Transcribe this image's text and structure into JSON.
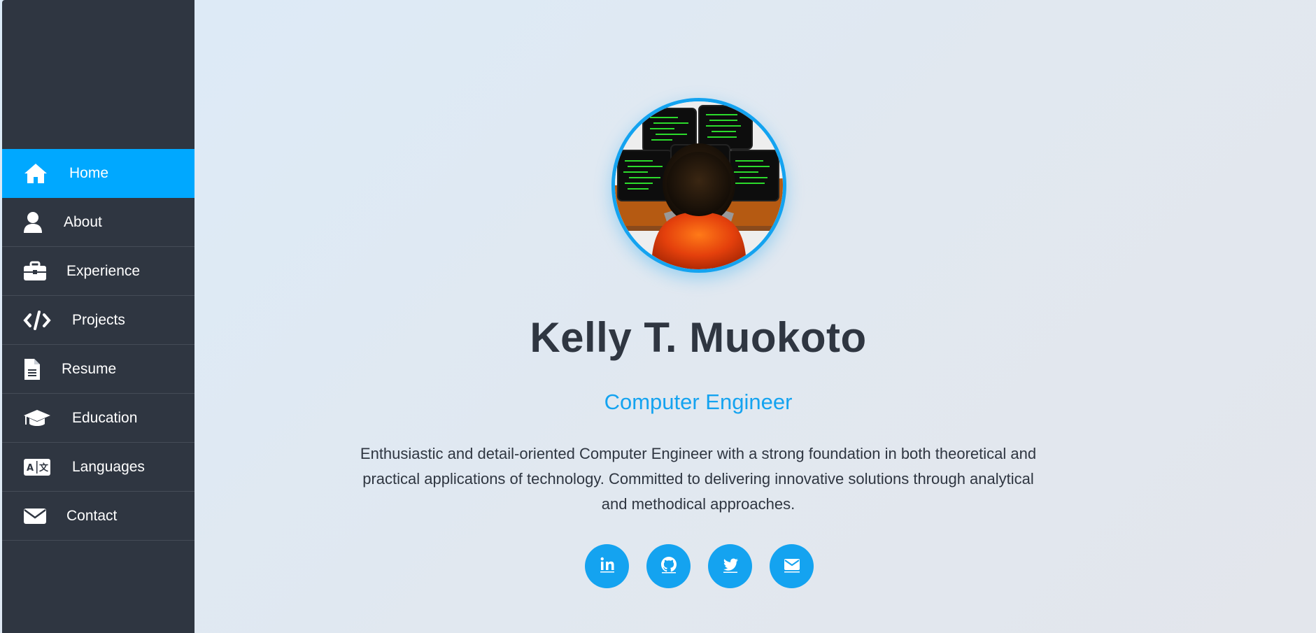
{
  "sidebar": {
    "items": [
      {
        "label": "Home",
        "icon": "home-icon",
        "active": true
      },
      {
        "label": "About",
        "icon": "user-icon",
        "active": false
      },
      {
        "label": "Experience",
        "icon": "briefcase-icon",
        "active": false
      },
      {
        "label": "Projects",
        "icon": "code-icon",
        "active": false
      },
      {
        "label": "Resume",
        "icon": "file-icon",
        "active": false
      },
      {
        "label": "Education",
        "icon": "graduation-cap-icon",
        "active": false
      },
      {
        "label": "Languages",
        "icon": "language-icon",
        "active": false
      },
      {
        "label": "Contact",
        "icon": "envelope-icon",
        "active": false
      }
    ]
  },
  "profile": {
    "name": "Kelly T. Muokoto",
    "title": "Computer Engineer",
    "bio": "Enthusiastic and detail-oriented Computer Engineer with a strong foundation in both theoretical and practical applications of technology. Committed to delivering innovative solutions through analytical and methodical approaches."
  },
  "socials": [
    {
      "icon": "linkedin-icon"
    },
    {
      "icon": "github-icon"
    },
    {
      "icon": "twitter-icon"
    },
    {
      "icon": "email-icon"
    }
  ],
  "colors": {
    "accent": "#14a3f0",
    "sidebar_bg": "#2f3641",
    "active_nav": "#00a8ff",
    "text_dark": "#2f3641"
  }
}
